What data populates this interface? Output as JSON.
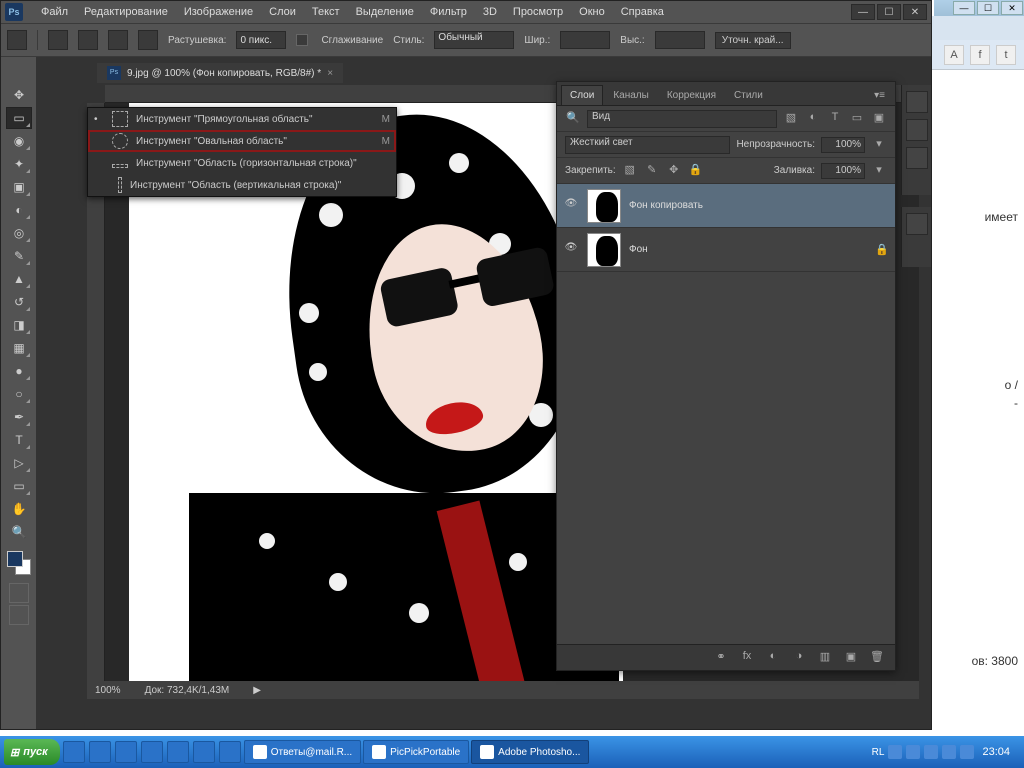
{
  "browser": {
    "social_a": "A",
    "social_f": "f",
    "social_t": "t",
    "text1": "имеет",
    "text2": "о /",
    "text3": "-",
    "views": "ов: 3800"
  },
  "menubar": {
    "file": "Файл",
    "edit": "Редактирование",
    "image": "Изображение",
    "layer": "Слои",
    "type": "Текст",
    "select": "Выделение",
    "filter": "Фильтр",
    "three_d": "3D",
    "view": "Просмотр",
    "window": "Окно",
    "help": "Справка",
    "logo": "Ps",
    "min": "—",
    "max": "☐",
    "close": "✕"
  },
  "optionbar": {
    "feather_label": "Растушевка:",
    "feather_value": "0 пикс.",
    "antialias": "Сглаживание",
    "style_label": "Стиль:",
    "style_value": "Обычный",
    "width_label": "Шир.:",
    "height_label": "Выс.:",
    "refine": "Уточн. край..."
  },
  "doc": {
    "title": "9.jpg @ 100% (Фон копировать, RGB/8#) *",
    "close": "×",
    "zoom": "100%",
    "docsize": "Док: 732,4K/1,43M"
  },
  "flyout": {
    "rect": "Инструмент \"Прямоугольная область\"",
    "oval": "Инструмент \"Овальная область\"",
    "row": "Инструмент \"Область (горизонтальная строка)\"",
    "col": "Инструмент \"Область (вертикальная строка)\"",
    "key": "M"
  },
  "panel": {
    "tab_layers": "Слои",
    "tab_channels": "Каналы",
    "tab_adjust": "Коррекция",
    "tab_styles": "Стили",
    "kind_label": "Вид",
    "blendmode": "Жесткий свет",
    "opacity_label": "Непрозрачность:",
    "opacity_value": "100%",
    "lock_label": "Закрепить:",
    "fill_label": "Заливка:",
    "fill_value": "100%",
    "layer1": "Фон копировать",
    "layer2": "Фон"
  },
  "taskbar": {
    "start": "пуск",
    "t1": "Ответы@mail.R...",
    "t2": "PicPickPortable",
    "t3": "Adobe Photosho...",
    "lang": "RL",
    "time": "23:04"
  }
}
